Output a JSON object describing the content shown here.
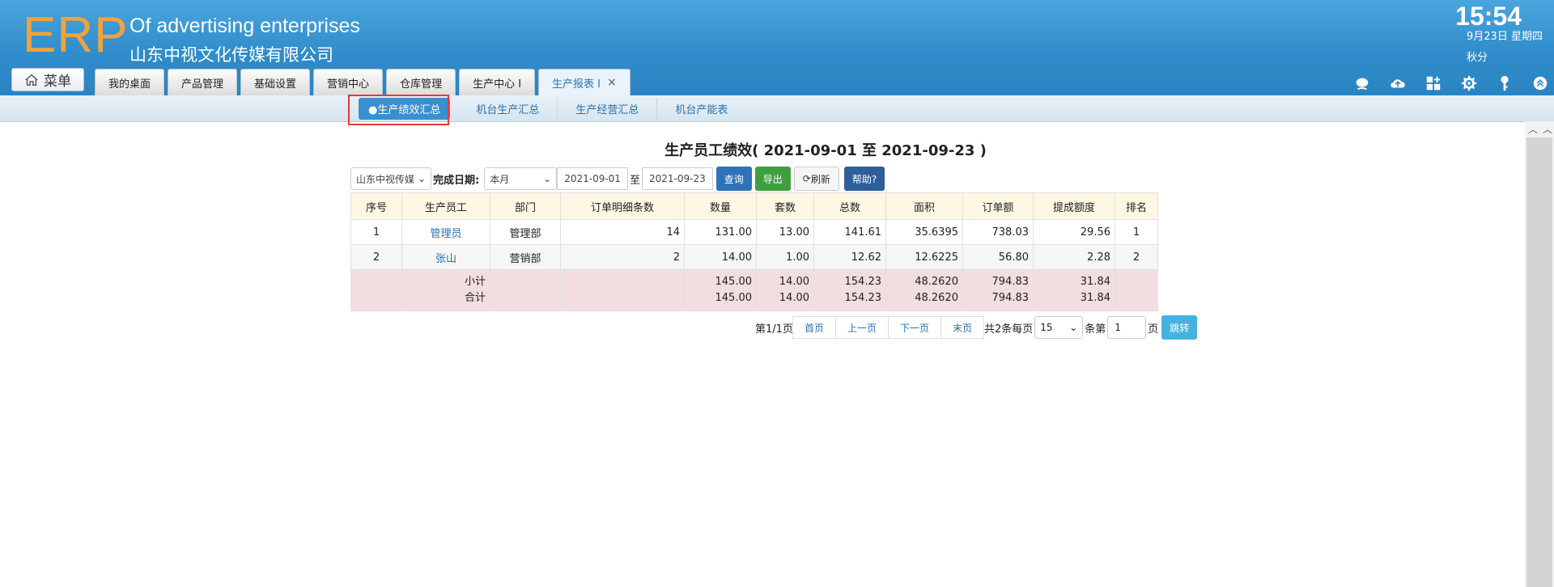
{
  "header": {
    "logo": "ERP",
    "system_name_en": "Of advertising enterprises",
    "company_name": "山东中视文化传媒有限公司",
    "time": "15:54",
    "date": "9月23日 星期四",
    "season": "秋分",
    "menu_label": "菜单"
  },
  "tabs": [
    {
      "label": "我的桌面"
    },
    {
      "label": "产品管理"
    },
    {
      "label": "基础设置"
    },
    {
      "label": "营销中心"
    },
    {
      "label": "仓库管理"
    },
    {
      "label": "生产中心 I"
    },
    {
      "label": "生产报表 I",
      "close": "×"
    }
  ],
  "subnav": [
    {
      "label": "●生产绩效汇总"
    },
    {
      "label": "机台生产汇总"
    },
    {
      "label": "生产经营汇总"
    },
    {
      "label": "机台产能表"
    }
  ],
  "report": {
    "title": "生产员工绩效( 2021-09-01 至 2021-09-23 )",
    "company_select": "山东中视传媒",
    "date_label": "完成日期:",
    "period_select": "本月",
    "date_from": "2021-09-01",
    "date_sep": "至",
    "date_to": "2021-09-23",
    "query_btn": "查询",
    "export_btn": "导出",
    "refresh_btn": "刷新",
    "help_btn": "帮助?"
  },
  "table": {
    "headers": [
      "序号",
      "生产员工",
      "部门",
      "订单明细条数",
      "数量",
      "套数",
      "总数",
      "面积",
      "订单额",
      "提成额度",
      "排名"
    ],
    "rows": [
      [
        "1",
        "管理员",
        "管理部",
        "14",
        "131.00",
        "13.00",
        "141.61",
        "35.6395",
        "738.03",
        "29.56",
        "1"
      ],
      [
        "2",
        "张山",
        "营销部",
        "2",
        "14.00",
        "1.00",
        "12.62",
        "12.6225",
        "56.80",
        "2.28",
        "2"
      ]
    ],
    "subtotal": {
      "label": "小计",
      "values": [
        "145.00",
        "14.00",
        "154.23",
        "48.2620",
        "794.83",
        "31.84"
      ]
    },
    "total": {
      "label": "合计",
      "values": [
        "145.00",
        "14.00",
        "154.23",
        "48.2620",
        "794.83",
        "31.84"
      ]
    }
  },
  "pager": {
    "page_info": "第1/1页",
    "first": "首页",
    "prev": "上一页",
    "next": "下一页",
    "last": "末页",
    "count_text": "共2条每页",
    "page_size": "15",
    "items_text": "条第",
    "page_input": "1",
    "page_text": "页",
    "go": "跳转"
  },
  "colors": {
    "header": "#3597d3",
    "logo": "#f3a23b",
    "subtotal_bg": "#f2dede",
    "header_row_bg": "#fdf7e3"
  }
}
